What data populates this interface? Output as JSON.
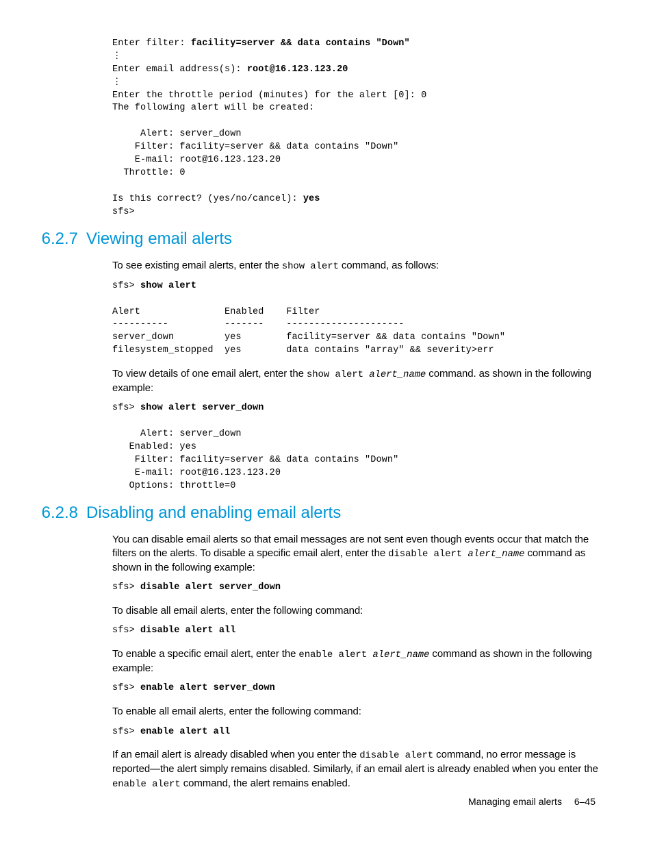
{
  "code_top_l1": "Enter filter: ",
  "code_top_l1b": "facility=server && data contains \"Down\"",
  "code_top_l2": "⋮",
  "code_top_l3": "Enter email address(s): ",
  "code_top_l3b": "root@16.123.123.20",
  "code_top_l4": "⋮",
  "code_top_l5": "Enter the throttle period (minutes) for the alert [0]: 0",
  "code_top_l6": "The following alert will be created:",
  "code_top_l7": "",
  "code_top_l8": "     Alert: server_down",
  "code_top_l9": "    Filter: facility=server && data contains \"Down\"",
  "code_top_l10": "    E-mail: root@16.123.123.20",
  "code_top_l11": "  Throttle: 0",
  "code_top_l12": "",
  "code_top_l13": "Is this correct? (yes/no/cancel): ",
  "code_top_l13b": "yes",
  "code_top_l14": "sfs>",
  "sec627_num": "6.2.7",
  "sec627_title": "Viewing email alerts",
  "p627_1a": "To see existing email alerts, enter the ",
  "p627_1b": "show alert",
  "p627_1c": " command, as follows:",
  "code627a_l1": "sfs> ",
  "code627a_l1b": "show alert",
  "code627a_l2": "",
  "code627a_l3": "Alert               Enabled    Filter",
  "code627a_l4": "----------          -------    ---------------------",
  "code627a_l5": "server_down         yes        facility=server && data contains \"Down\"",
  "code627a_l6": "filesystem_stopped  yes        data contains \"array\" && severity>err",
  "p627_2a": "To view details of one email alert, enter the ",
  "p627_2b": "show alert ",
  "p627_2c": "alert_name",
  "p627_2d": " command. as shown in the following example:",
  "code627b_l1": "sfs> ",
  "code627b_l1b": "show alert server_down",
  "code627b_l2": "",
  "code627b_l3": "     Alert: server_down",
  "code627b_l4": "   Enabled: yes",
  "code627b_l5": "    Filter: facility=server && data contains \"Down\"",
  "code627b_l6": "    E-mail: root@16.123.123.20",
  "code627b_l7": "   Options: throttle=0",
  "sec628_num": "6.2.8",
  "sec628_title": "Disabling and enabling email alerts",
  "p628_1a": "You can disable email alerts so that email messages are not sent even though events occur that match the filters on the alerts. To disable a specific email alert, enter the ",
  "p628_1b": "disable alert ",
  "p628_1c": "alert_name",
  "p628_1d": " command as shown in the following example:",
  "code628a_l1": "sfs> ",
  "code628a_l1b": "disable alert server_down",
  "p628_2": "To disable all email alerts, enter the following command:",
  "code628b_l1": "sfs> ",
  "code628b_l1b": "disable alert all",
  "p628_3a": "To enable a specific email alert, enter the ",
  "p628_3b": "enable alert ",
  "p628_3c": "alert_name",
  "p628_3d": " command as shown in the following example:",
  "code628c_l1": "sfs> ",
  "code628c_l1b": "enable alert server_down",
  "p628_4": "To enable all email alerts, enter the following command:",
  "code628d_l1": "sfs> ",
  "code628d_l1b": "enable alert all",
  "p628_5a": "If an email alert is already disabled when you enter the ",
  "p628_5b": "disable alert",
  "p628_5c": " command, no error message is reported—the alert simply remains disabled. Similarly, if an email alert is already enabled when you enter the ",
  "p628_5d": "enable alert",
  "p628_5e": " command, the alert remains enabled.",
  "footer_text": "Managing email alerts",
  "footer_page": "6–45"
}
